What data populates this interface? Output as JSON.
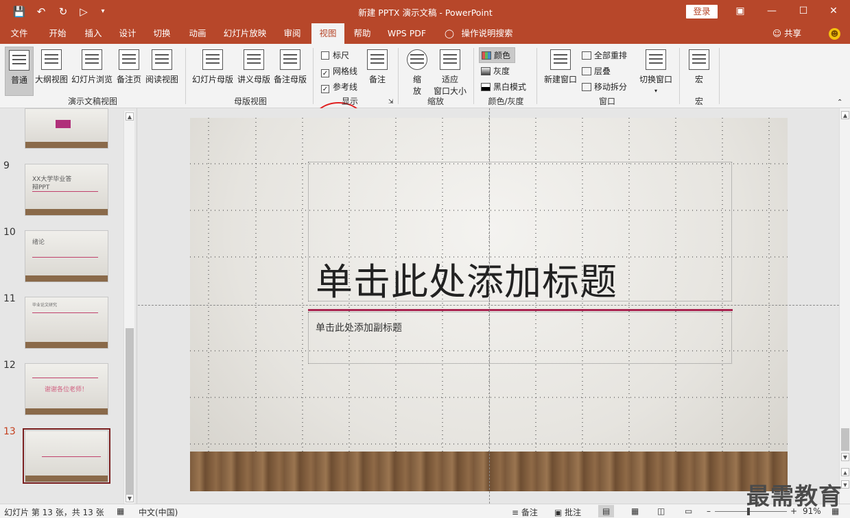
{
  "window": {
    "title": "新建 PPTX 演示文稿 - PowerPoint",
    "login_label": "登录",
    "share_label": "共享"
  },
  "tabs": [
    "文件",
    "开始",
    "插入",
    "设计",
    "切换",
    "动画",
    "幻灯片放映",
    "审阅",
    "视图",
    "帮助",
    "WPS PDF",
    "操作说明搜索"
  ],
  "active_tab": "视图",
  "ribbon": {
    "presentation_views": {
      "label": "演示文稿视图",
      "buttons": [
        "普通",
        "大纲视图",
        "幻灯片浏览",
        "备注页",
        "阅读视图"
      ]
    },
    "master_views": {
      "label": "母版视图",
      "buttons": [
        "幻灯片母版",
        "讲义母版",
        "备注母版"
      ]
    },
    "show": {
      "label": "显示",
      "ruler": {
        "label": "标尺",
        "checked": false
      },
      "gridlines": {
        "label": "网格线",
        "checked": true
      },
      "guides": {
        "label": "参考线",
        "checked": true
      },
      "notes_label": "备注"
    },
    "zoom": {
      "label": "缩放",
      "zoom_button": "缩\n放",
      "fit_line1": "适应",
      "fit_line2": "窗口大小",
      "zoom_line1": "缩",
      "zoom_line2": "放"
    },
    "color": {
      "label": "颜色/灰度",
      "color": "颜色",
      "grayscale": "灰度",
      "bw": "黑白模式"
    },
    "window": {
      "label": "窗口",
      "new_window": "新建窗口",
      "arrange_all": "全部重排",
      "cascade": "层叠",
      "move_split": "移动拆分",
      "switch_windows": "切换窗口"
    },
    "macros": {
      "label": "宏",
      "button": "宏"
    }
  },
  "slides": [
    {
      "number": "9",
      "line1": "XX大学毕业答",
      "line2": "辩PPT"
    },
    {
      "number": "10",
      "title": "绪论"
    },
    {
      "number": "11",
      "title": "毕业论文研究"
    },
    {
      "number": "12",
      "title": "谢谢各位老师！"
    },
    {
      "number": "13"
    }
  ],
  "main_slide": {
    "title_placeholder": "单击此处添加标题",
    "subtitle_placeholder": "单击此处添加副标题"
  },
  "status": {
    "slide_info": "幻灯片 第 13 张，共 13 张",
    "language": "中文(中国)",
    "notes": "备注",
    "comments": "批注",
    "zoom": "91%"
  },
  "watermark": "最需教育",
  "colors": {
    "accent": "#b7472a",
    "slide_accent": "#a8234f"
  }
}
